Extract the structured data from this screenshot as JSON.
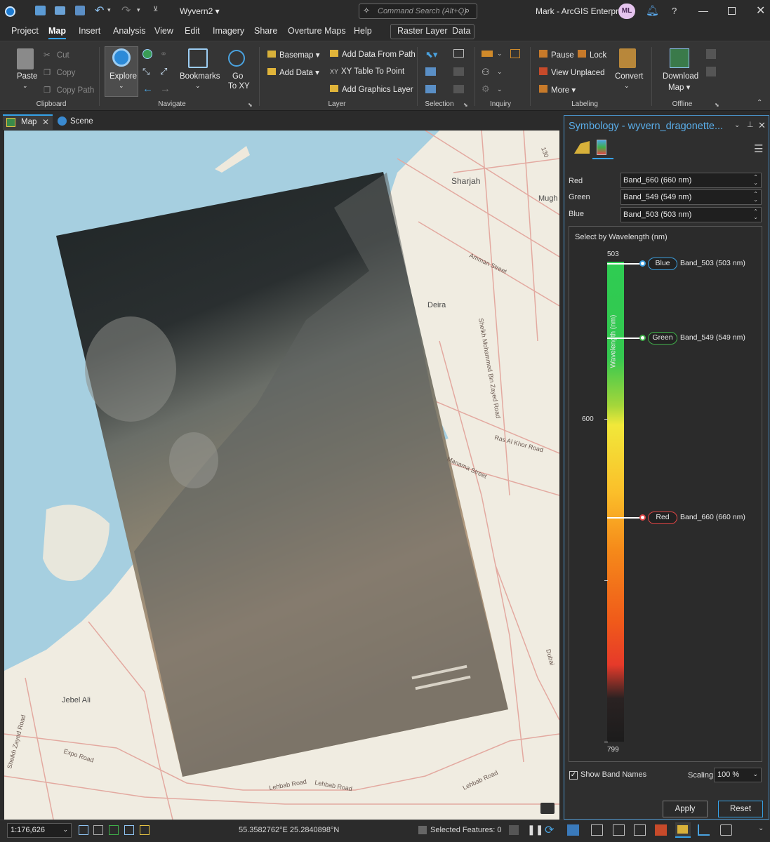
{
  "titlebar": {
    "project_name": "Wyvern2",
    "search_placeholder": "Command Search (Alt+Q)",
    "user": "Mark - ArcGIS Enterprise",
    "avatar_initials": "ML"
  },
  "ribbon_tabs": [
    "Project",
    "Map",
    "Insert",
    "Analysis",
    "View",
    "Edit",
    "Imagery",
    "Share",
    "Overture Maps",
    "Help"
  ],
  "contextual_tabs": [
    "Raster Layer",
    "Data"
  ],
  "ribbon": {
    "clipboard": {
      "paste": "Paste",
      "cut": "Cut",
      "copy": "Copy",
      "copy_path": "Copy Path",
      "label": "Clipboard"
    },
    "navigate": {
      "explore": "Explore",
      "bookmarks": "Bookmarks",
      "go": "Go",
      "to_xy": "To XY",
      "label": "Navigate"
    },
    "layer": {
      "basemap": "Basemap",
      "add_data": "Add Data",
      "add_from_path": "Add Data From Path",
      "xy_table": "XY Table To Point",
      "add_graphics": "Add Graphics Layer",
      "label": "Layer"
    },
    "selection": {
      "label": "Selection"
    },
    "inquiry": {
      "label": "Inquiry"
    },
    "labeling": {
      "pause": "Pause",
      "lock": "Lock",
      "view_unplaced": "View Unplaced",
      "more": "More",
      "convert": "Convert",
      "label": "Labeling"
    },
    "offline": {
      "download": "Download",
      "map": "Map",
      "label": "Offline"
    }
  },
  "view_tabs": [
    {
      "label": "Map",
      "active": true
    },
    {
      "label": "Scene",
      "active": false
    }
  ],
  "map": {
    "places": [
      "Sharjah",
      "Mugh",
      "Deira",
      "Jebel Ali"
    ],
    "roads": [
      "Amman Street",
      "Sheikh Mohammed Bin Zayed Road",
      "Ras Al Khor Road",
      "Manama Street",
      "Expo Road",
      "Lehbab Road",
      "Lehbab Road",
      "Lehbab Road",
      "Sheikh Zayed Road",
      "Dubai",
      "130"
    ]
  },
  "status": {
    "scale": "1:176,626",
    "coords": "55.3582762°E 25.2840898°N",
    "selected": "Selected Features: 0"
  },
  "pane": {
    "title": "Symbology - wyvern_dragonette...",
    "red_label": "Red",
    "green_label": "Green",
    "blue_label": "Blue",
    "red_value": "Band_660 (660 nm)",
    "green_value": "Band_549 (549 nm)",
    "blue_value": "Band_503 (503 nm)",
    "select_by_wavelength": "Select by Wavelength (nm)",
    "axis_title": "Wavelength (nm)",
    "tick_top": "503",
    "tick_mid": "600",
    "tick_bottom": "799",
    "markers": [
      {
        "name": "Blue",
        "band": "Band_503 (503 nm)",
        "wavelength": 503,
        "color": "#3b9ede"
      },
      {
        "name": "Green",
        "band": "Band_549 (549 nm)",
        "wavelength": 549,
        "color": "#3fae49"
      },
      {
        "name": "Red",
        "band": "Band_660 (660 nm)",
        "wavelength": 660,
        "color": "#e04545"
      }
    ],
    "show_band_names": "Show Band Names",
    "scaling_label": "Scaling",
    "scaling_value": "100 %",
    "apply": "Apply",
    "reset": "Reset"
  },
  "colors": {
    "accent": "#35a2e8",
    "ribbon_bg": "#353535",
    "app_bg": "#2b2b2b",
    "water": "#a6cfe0",
    "land": "#f0ece1"
  }
}
